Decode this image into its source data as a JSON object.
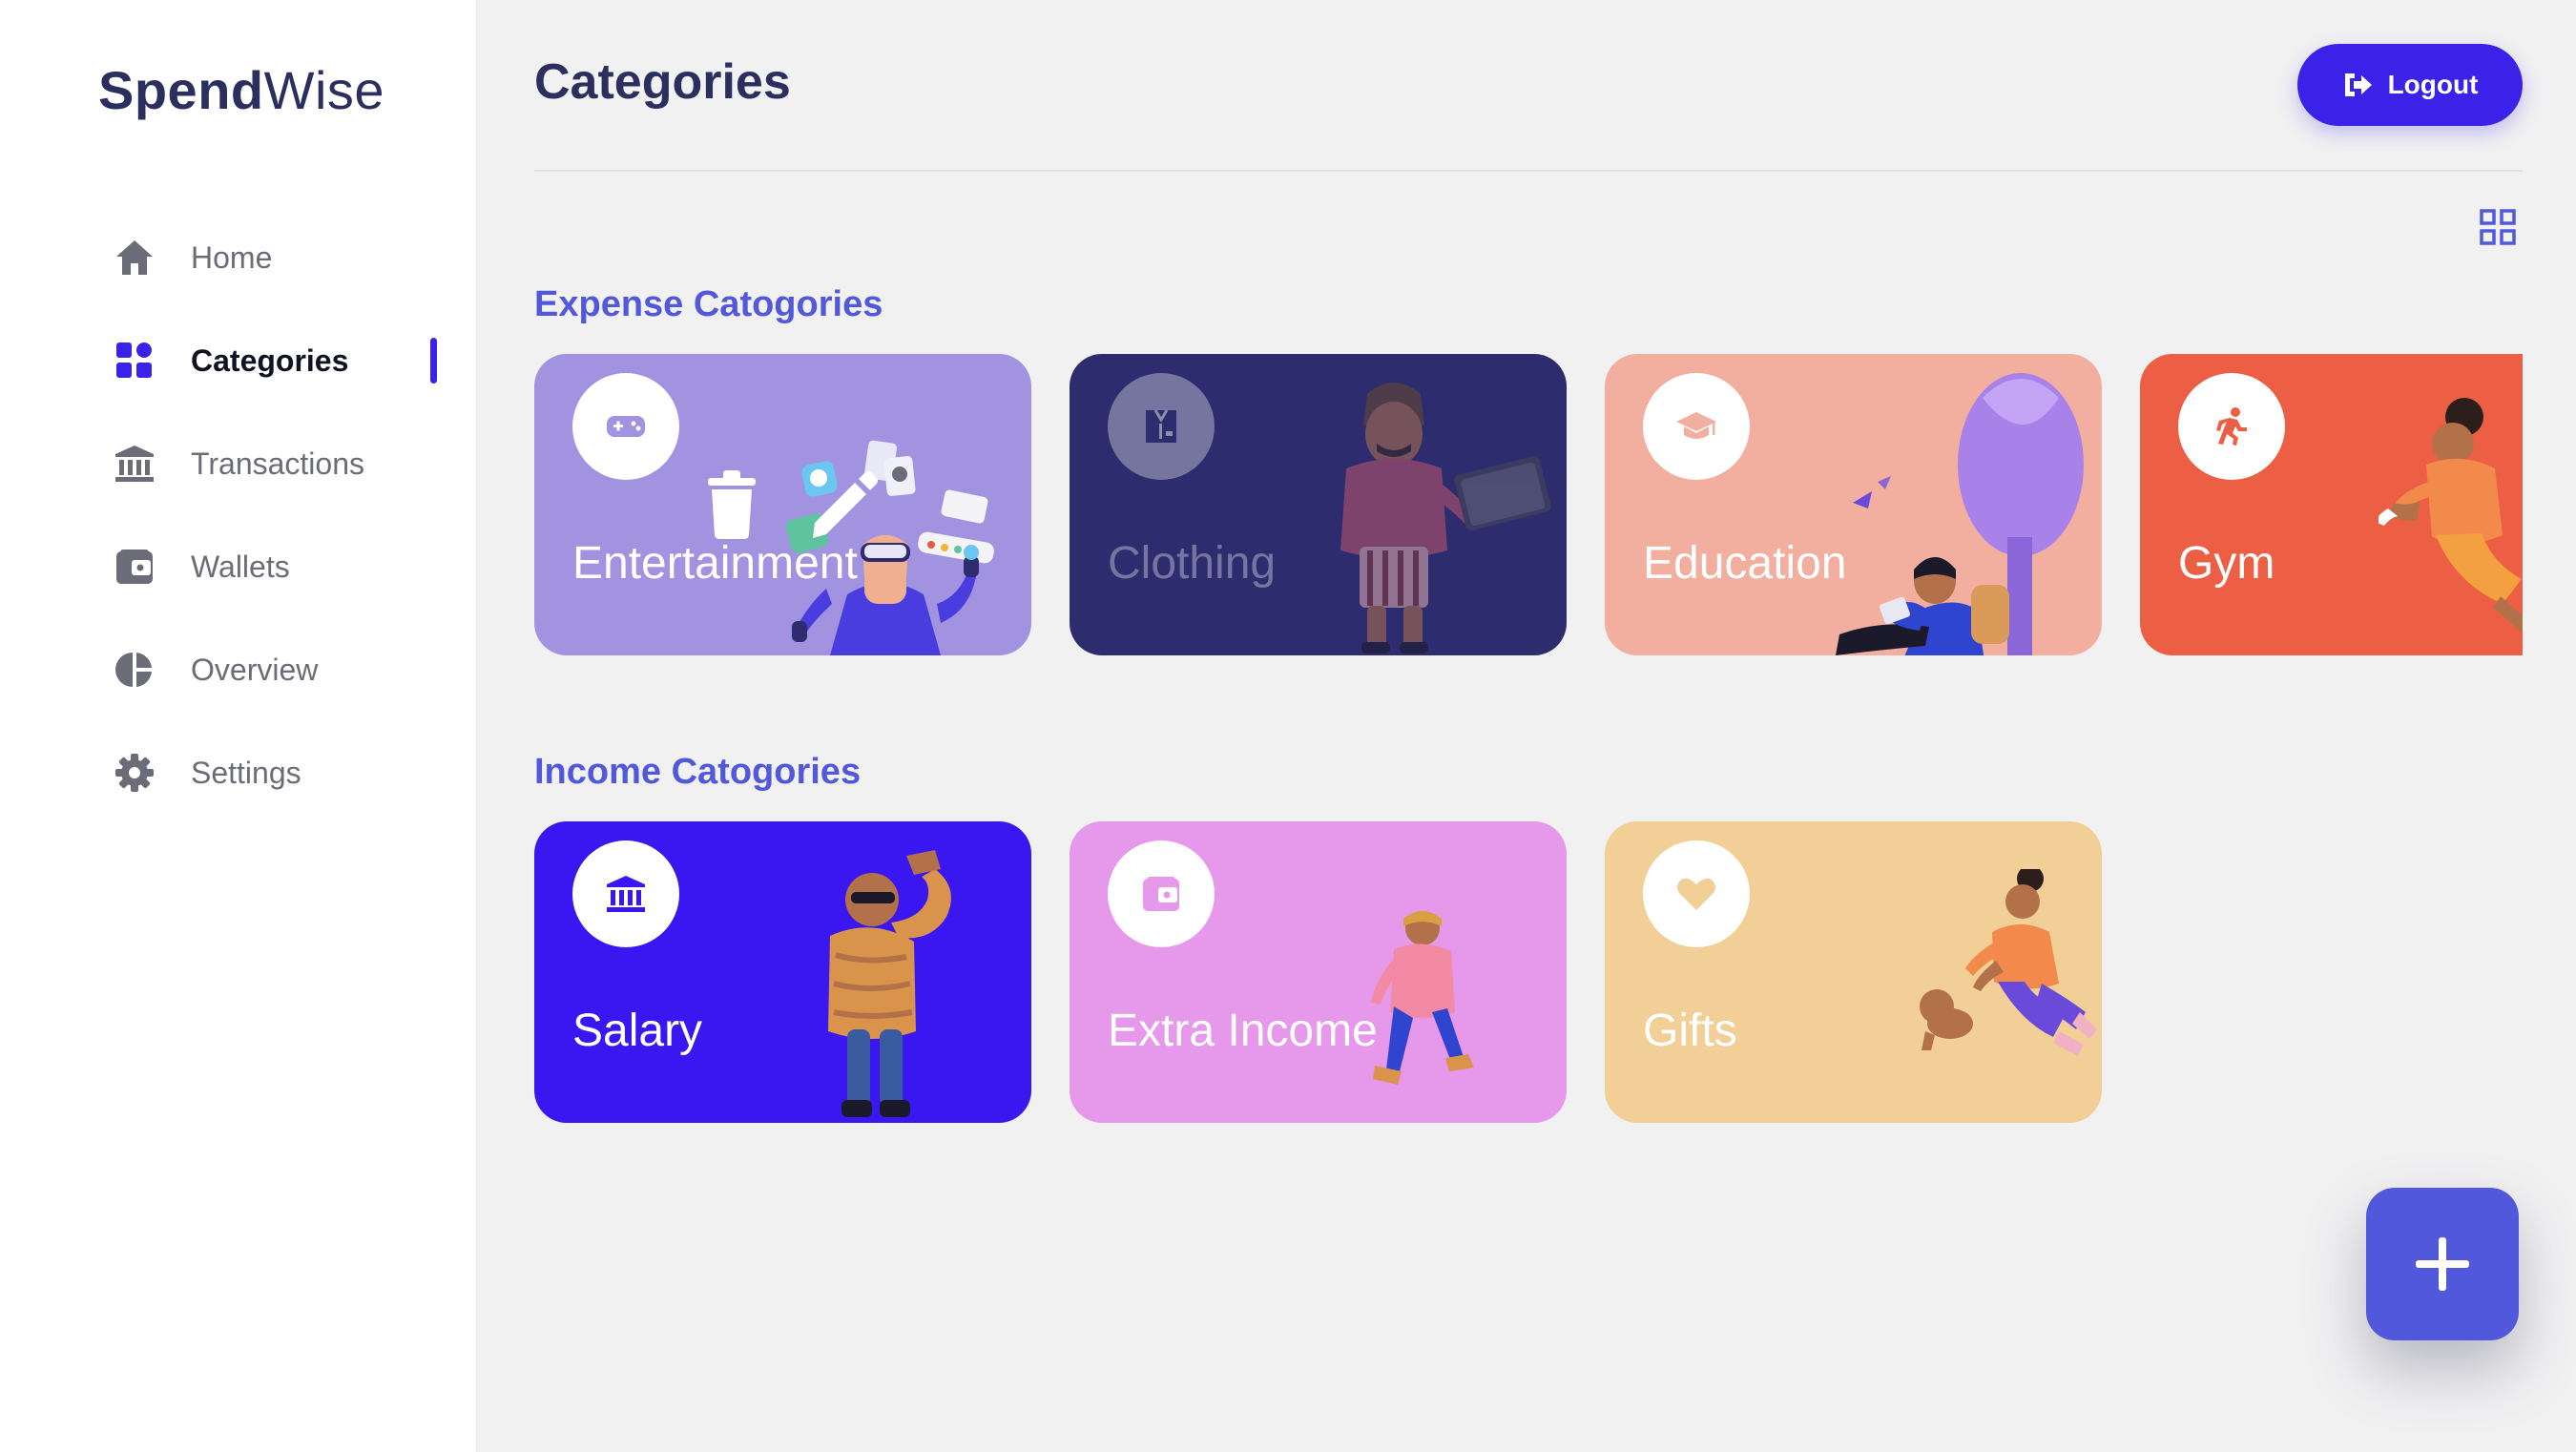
{
  "app": {
    "logo_bold": "Spend",
    "logo_light": "Wise"
  },
  "sidebar": {
    "items": [
      {
        "label": "Home",
        "icon": "home-icon",
        "active": false
      },
      {
        "label": "Categories",
        "icon": "categories-icon",
        "active": true
      },
      {
        "label": "Transactions",
        "icon": "bank-icon",
        "active": false
      },
      {
        "label": "Wallets",
        "icon": "wallet-icon",
        "active": false
      },
      {
        "label": "Overview",
        "icon": "pie-chart-icon",
        "active": false
      },
      {
        "label": "Settings",
        "icon": "gear-icon",
        "active": false
      }
    ]
  },
  "header": {
    "title": "Categories",
    "logout_label": "Logout"
  },
  "expense": {
    "title": "Expense Catogories",
    "cards": [
      {
        "label": "Entertainment",
        "icon": "gamepad-icon",
        "color": "#a293e0"
      },
      {
        "label": "Clothing",
        "icon": "shirt-icon",
        "color": "#2c2c6e"
      },
      {
        "label": "Education",
        "icon": "graduation-cap-icon",
        "color": "#f2afa0"
      },
      {
        "label": "Gym",
        "icon": "running-icon",
        "color": "#ec5f45"
      }
    ]
  },
  "income": {
    "title": "Income Catogories",
    "cards": [
      {
        "label": "Salary",
        "icon": "bank-icon",
        "color": "#3a17f0"
      },
      {
        "label": "Extra Income",
        "icon": "wallet-icon",
        "color": "#e698ea"
      },
      {
        "label": "Gifts",
        "icon": "heart-icon",
        "color": "#f2cf96"
      }
    ]
  },
  "colors": {
    "accent": "#3a22e8",
    "section_title": "#5158dc",
    "background": "#f1f1f2"
  }
}
